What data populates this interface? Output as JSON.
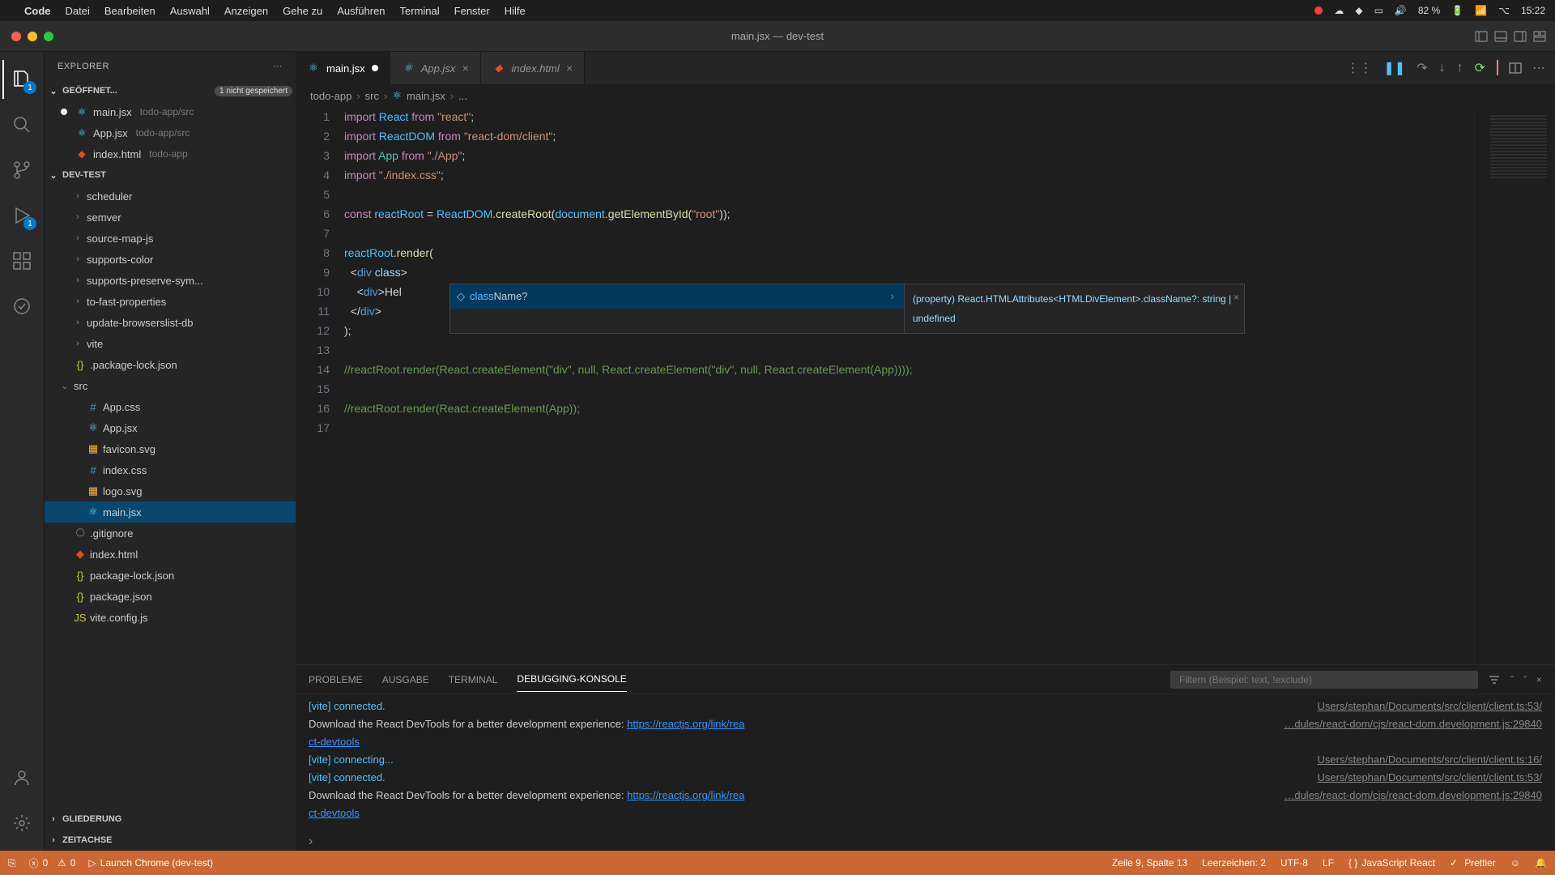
{
  "menubar": {
    "app": "Code",
    "items": [
      "Datei",
      "Bearbeiten",
      "Auswahl",
      "Anzeigen",
      "Gehe zu",
      "Ausführen",
      "Terminal",
      "Fenster",
      "Hilfe"
    ],
    "battery": "82 %",
    "time": "15:22"
  },
  "titlebar": {
    "title": "main.jsx — dev-test"
  },
  "activity": {
    "explorer_badge": "1",
    "debug_badge": "1"
  },
  "sidebar": {
    "title": "EXPLORER",
    "open_editors_label": "GEÖFFNET...",
    "unsaved_badge": "1 nicht gespeichert",
    "open_editors": [
      {
        "name": "main.jsx",
        "path": "todo-app/src",
        "modified": true
      },
      {
        "name": "App.jsx",
        "path": "todo-app/src",
        "modified": false
      },
      {
        "name": "index.html",
        "path": "todo-app",
        "modified": false
      }
    ],
    "project_label": "DEV-TEST",
    "tree": [
      {
        "indent": 1,
        "type": "folder",
        "name": "scheduler"
      },
      {
        "indent": 1,
        "type": "folder",
        "name": "semver"
      },
      {
        "indent": 1,
        "type": "folder",
        "name": "source-map-js"
      },
      {
        "indent": 1,
        "type": "folder",
        "name": "supports-color"
      },
      {
        "indent": 1,
        "type": "folder",
        "name": "supports-preserve-sym..."
      },
      {
        "indent": 1,
        "type": "folder",
        "name": "to-fast-properties"
      },
      {
        "indent": 1,
        "type": "folder",
        "name": "update-browserslist-db"
      },
      {
        "indent": 1,
        "type": "folder",
        "name": "vite"
      },
      {
        "indent": 0,
        "type": "json",
        "name": ".package-lock.json"
      },
      {
        "indent": 0,
        "type": "folder-open",
        "name": "src"
      },
      {
        "indent": 1,
        "type": "css",
        "name": "App.css"
      },
      {
        "indent": 1,
        "type": "react",
        "name": "App.jsx"
      },
      {
        "indent": 1,
        "type": "svg",
        "name": "favicon.svg"
      },
      {
        "indent": 1,
        "type": "css",
        "name": "index.css"
      },
      {
        "indent": 1,
        "type": "svg",
        "name": "logo.svg"
      },
      {
        "indent": 1,
        "type": "react",
        "name": "main.jsx",
        "selected": true
      },
      {
        "indent": 0,
        "type": "file",
        "name": ".gitignore"
      },
      {
        "indent": 0,
        "type": "html",
        "name": "index.html"
      },
      {
        "indent": 0,
        "type": "json",
        "name": "package-lock.json"
      },
      {
        "indent": 0,
        "type": "json",
        "name": "package.json"
      },
      {
        "indent": 0,
        "type": "js",
        "name": "vite.config.js"
      }
    ],
    "outline_label": "GLIEDERUNG",
    "timeline_label": "ZEITACHSE"
  },
  "tabs": [
    {
      "name": "main.jsx",
      "active": true,
      "modified": true,
      "icon": "react"
    },
    {
      "name": "App.jsx",
      "active": false,
      "modified": false,
      "icon": "react"
    },
    {
      "name": "index.html",
      "active": false,
      "modified": false,
      "icon": "html"
    }
  ],
  "breadcrumbs": [
    "todo-app",
    "src",
    "main.jsx",
    "..."
  ],
  "code": {
    "lines": 17
  },
  "autocomplete": {
    "match": "class",
    "rest": "Name?",
    "detail": "(property) React.HTMLAttributes<HTMLDivElement>.className?: string | undefined"
  },
  "panel": {
    "tabs": [
      "PROBLEME",
      "AUSGABE",
      "TERMINAL",
      "DEBUGGING-KONSOLE"
    ],
    "active_tab": 3,
    "filter_placeholder": "Filtern (Beispiel: text, !exclude)",
    "logs": [
      {
        "left_type": "info",
        "left": "[vite] connected.",
        "right": "Users/stephan/Documents/src/client/client.ts:53/"
      },
      {
        "left_type": "text",
        "left": "Download the React DevTools for a better development experience: ",
        "link": "https://reactjs.org/link/rea",
        "right": "…dules/react-dom/cjs/react-dom.development.js:29840"
      },
      {
        "left_type": "link",
        "left": "ct-devtools",
        "right": ""
      },
      {
        "left_type": "info",
        "left": "[vite] connecting...",
        "right": "Users/stephan/Documents/src/client/client.ts:16/"
      },
      {
        "left_type": "info",
        "left": "[vite] connected.",
        "right": "Users/stephan/Documents/src/client/client.ts:53/"
      },
      {
        "left_type": "text",
        "left": "Download the React DevTools for a better development experience: ",
        "link": "https://reactjs.org/link/rea",
        "right": "…dules/react-dom/cjs/react-dom.development.js:29840"
      },
      {
        "left_type": "link",
        "left": "ct-devtools",
        "right": ""
      }
    ]
  },
  "statusbar": {
    "errors": "0",
    "warnings": "0",
    "launch": "Launch Chrome (dev-test)",
    "position": "Zeile 9, Spalte 13",
    "spaces": "Leerzeichen: 2",
    "encoding": "UTF-8",
    "eol": "LF",
    "lang": "JavaScript React",
    "prettier": "Prettier"
  }
}
